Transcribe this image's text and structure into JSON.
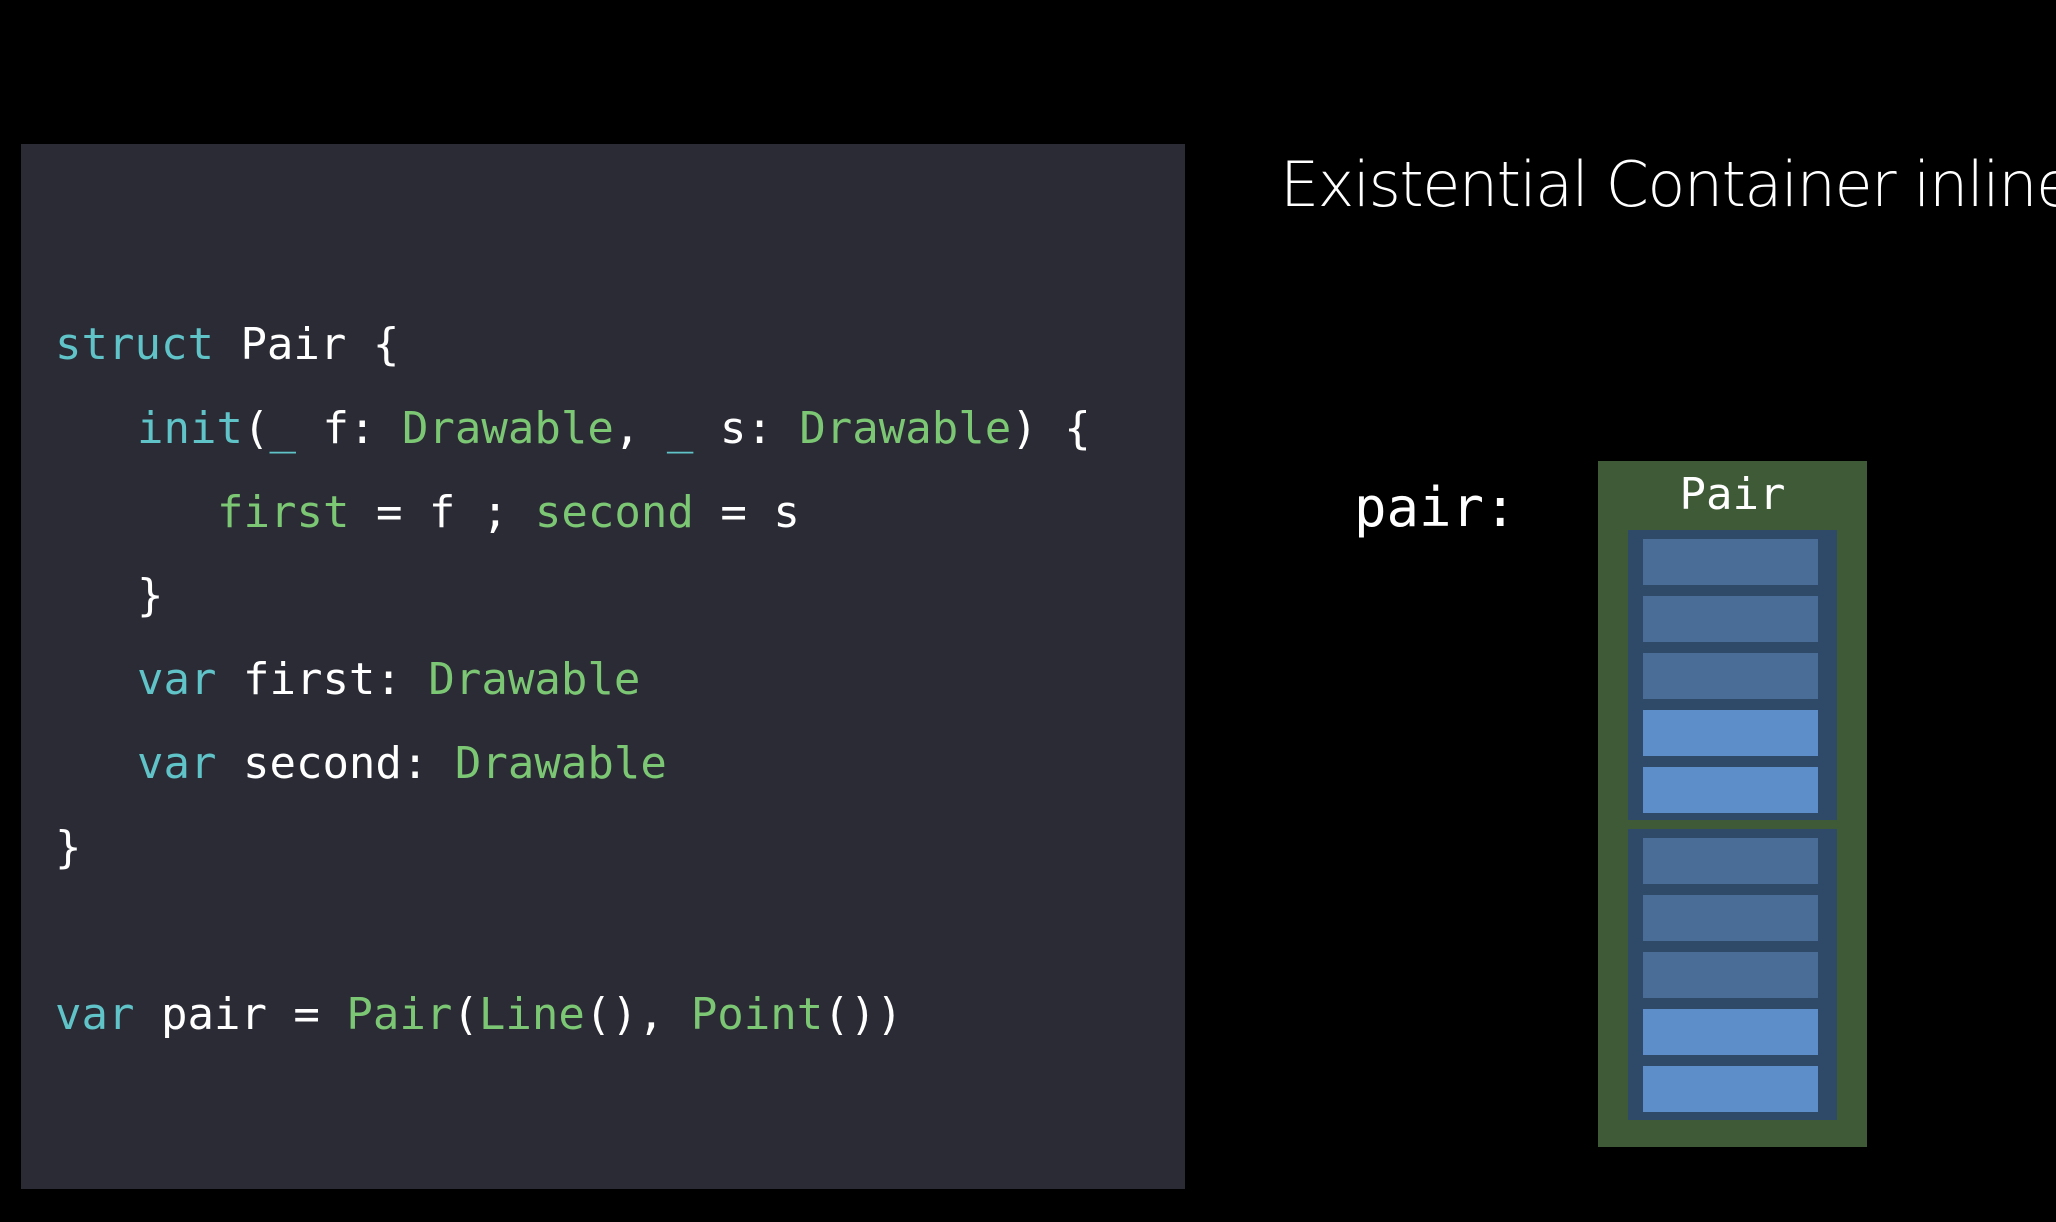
{
  "code": {
    "lines": [
      [
        {
          "t": "struct",
          "c": "kw"
        },
        {
          "t": " Pair {",
          "c": "pl"
        }
      ],
      [
        {
          "t": "init",
          "c": "kw"
        },
        {
          "t": "(",
          "c": "pl"
        },
        {
          "t": "_",
          "c": "kw"
        },
        {
          "t": " f: ",
          "c": "pl"
        },
        {
          "t": "Drawable",
          "c": "ty"
        },
        {
          "t": ", ",
          "c": "pl"
        },
        {
          "t": "_",
          "c": "kw"
        },
        {
          "t": " s: ",
          "c": "pl"
        },
        {
          "t": "Drawable",
          "c": "ty"
        },
        {
          "t": ") {",
          "c": "pl"
        }
      ],
      [
        {
          "t": "first",
          "c": "ty"
        },
        {
          "t": " = f ; ",
          "c": "pl"
        },
        {
          "t": "second",
          "c": "ty"
        },
        {
          "t": " = s",
          "c": "pl"
        }
      ],
      [
        {
          "t": "}",
          "c": "pl"
        }
      ],
      [
        {
          "t": "var",
          "c": "kw"
        },
        {
          "t": " first: ",
          "c": "pl"
        },
        {
          "t": "Drawable",
          "c": "ty"
        }
      ],
      [
        {
          "t": "var",
          "c": "kw"
        },
        {
          "t": " second: ",
          "c": "pl"
        },
        {
          "t": "Drawable",
          "c": "ty"
        }
      ],
      [
        {
          "t": "}",
          "c": "pl"
        }
      ],
      [
        {
          "t": "var",
          "c": "kw"
        },
        {
          "t": " pair = ",
          "c": "pl"
        },
        {
          "t": "Pair",
          "c": "ty"
        },
        {
          "t": "(",
          "c": "pl"
        },
        {
          "t": "Line",
          "c": "ty"
        },
        {
          "t": "(), ",
          "c": "pl"
        },
        {
          "t": "Point",
          "c": "ty"
        },
        {
          "t": "())",
          "c": "pl"
        }
      ]
    ]
  },
  "slide": {
    "title": "Existential Container inline"
  },
  "diagram": {
    "variable_label": "pair:",
    "struct_label": "Pair",
    "containers": [
      {
        "cells": [
          "value-buffer",
          "value-buffer",
          "value-buffer",
          "vwt",
          "pwt"
        ]
      },
      {
        "cells": [
          "value-buffer",
          "value-buffer",
          "value-buffer",
          "vwt",
          "pwt"
        ]
      }
    ]
  },
  "colors": {
    "background": "#000000",
    "code_panel": "#2b2b35",
    "keyword": "#5fc3c8",
    "type": "#7cc774",
    "plain": "#ffffff",
    "pair_box": "#3e5a36",
    "container": "#2f4a68",
    "cell_dim": "#4a6d97",
    "cell_bright": "#5e8ec9"
  }
}
